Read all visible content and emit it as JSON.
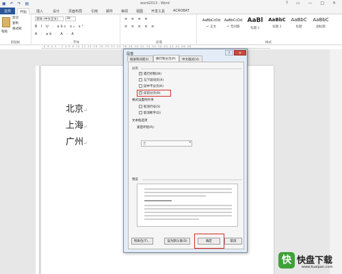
{
  "window": {
    "title": "word2013 - Word",
    "qat_icons": [
      "save-icon",
      "undo-icon",
      "redo-icon",
      "doc-icon"
    ],
    "controls": [
      "?",
      "▭",
      "—",
      "□",
      "✕"
    ]
  },
  "tabs": [
    "文件",
    "开始",
    "插入",
    "设计",
    "页面布局",
    "引用",
    "邮件",
    "审阅",
    "视图",
    "开发工具",
    "ACROBAT"
  ],
  "active_tab": "开始",
  "ribbon": {
    "clipboard": {
      "paste": "粘贴",
      "cut": "剪切",
      "copy": "复制",
      "format_painter": "格式刷",
      "label": "剪贴板"
    },
    "font": {
      "font_name": "宋体 (中文正文)",
      "font_size": "28",
      "format_row": "B I U · abc x₂ x²",
      "color_row": "A · ab · A · A",
      "label": "字体"
    },
    "paragraph": {
      "row1": "≡ ≡ ≡ ≡",
      "row2": "≡ ≡ ≡ ≡ ≡",
      "label": "段落"
    },
    "styles": {
      "items": [
        {
          "preview": "AaBbCcDd",
          "name": "↵ 正文"
        },
        {
          "preview": "AaBbCcDd",
          "name": "↵ 无间隔"
        },
        {
          "preview": "AaBl",
          "name": "标题 1"
        },
        {
          "preview": "AaBbC",
          "name": "标题 2"
        },
        {
          "preview": "AaBbC",
          "name": "标题"
        },
        {
          "preview": "AaBbC",
          "name": "副标题"
        }
      ],
      "label": "样式"
    }
  },
  "ruler": "8 6 4 2 · 2 4 6 8 10 12 14 16 18 20 22 24 26 28 30 32 34 36 38 40 42 44 46 48",
  "document": {
    "lines": [
      "北京",
      "上海",
      "广州"
    ],
    "para_mark": "↵"
  },
  "dialog": {
    "title": "段落",
    "help": "?",
    "close": "✕",
    "tabs": [
      "缩进和间距(I)",
      "换行和分页(P)",
      "中文版式(H)"
    ],
    "active_tab": "换行和分页(P)",
    "pagination_label": "分页",
    "pagination_options": [
      {
        "label": "孤行控制(W)",
        "checked": true
      },
      {
        "label": "与下段同页(X)",
        "checked": false
      },
      {
        "label": "段中不分页(K)",
        "checked": false
      },
      {
        "label": "段前分页(B)",
        "checked": true
      }
    ],
    "format_exceptions_label": "格式设置例外项",
    "format_exceptions": [
      {
        "label": "取消行号(S)",
        "checked": false
      },
      {
        "label": "取消断字(D)",
        "checked": false
      }
    ],
    "textbox_label": "文本框选项",
    "tight_wrap_label": "紧密环绕(R):",
    "tight_wrap_value": "无",
    "preview_label": "预览",
    "buttons": {
      "tabs": "制表位(T)...",
      "default": "设为默认值(D)",
      "ok": "确定",
      "cancel": "取消"
    }
  },
  "watermark": {
    "logo_char": "快",
    "text": "快盘下载",
    "url": "www.kuaipan.com"
  },
  "colors": {
    "accent": "#2b579a",
    "highlight": "#d42b2b",
    "dialog_bg": "#e4edf7",
    "watermark_green": "#3ea238"
  }
}
